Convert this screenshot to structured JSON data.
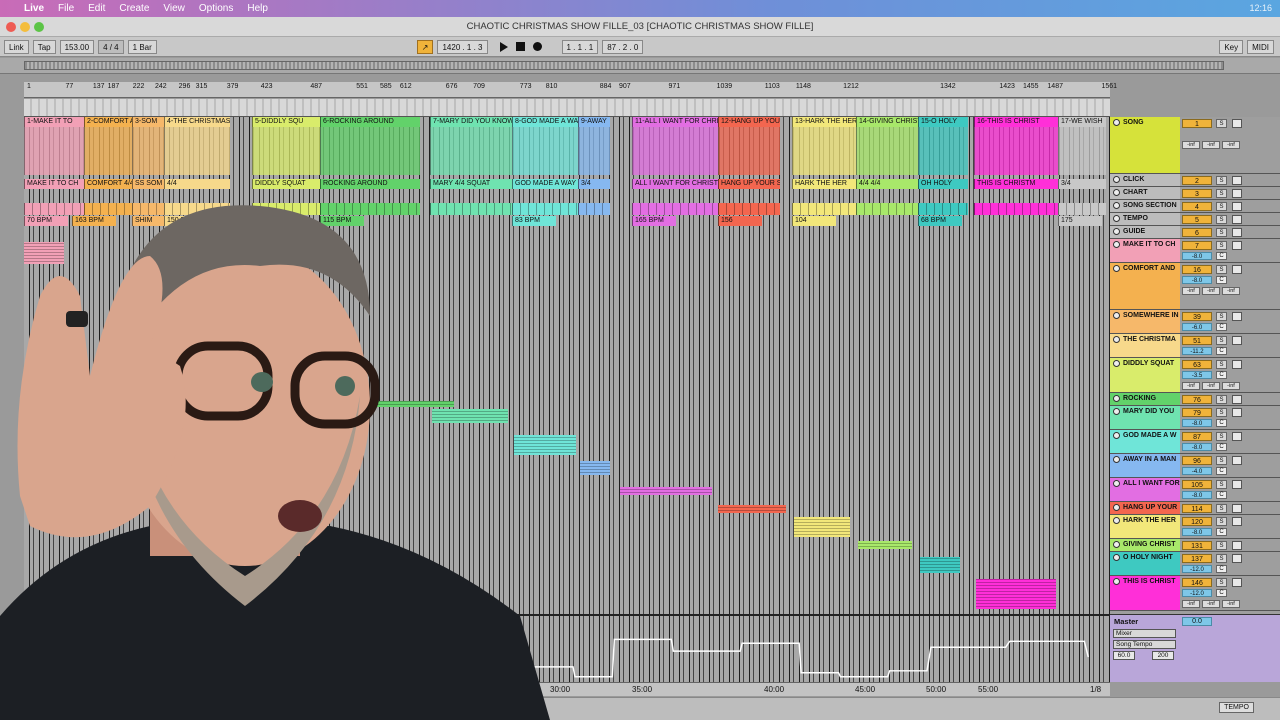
{
  "menubar": {
    "app": "Live",
    "items": [
      "File",
      "Edit",
      "Create",
      "View",
      "Options",
      "Help"
    ],
    "clock": "12:16"
  },
  "window": {
    "title": "CHAOTIC CHRISTMAS SHOW FILLE_03  [CHAOTIC CHRISTMAS SHOW FILLE]"
  },
  "transport": {
    "link": "Link",
    "tap": "Tap",
    "tempo": "153.00",
    "signature": "4 / 4",
    "quantize": "1 Bar",
    "position": "1420 .  1 .  3",
    "loop_start": "1 .  1 .  1",
    "loop_length": "87 .  2 .  0",
    "key": "Key",
    "midi": "MIDI"
  },
  "ruler": {
    "bars": [
      "1",
      "77",
      "137",
      "187",
      "222",
      "242",
      "296",
      "315",
      "379",
      "423",
      "487",
      "551",
      "585",
      "612",
      "676",
      "709",
      "773",
      "810",
      "884",
      "907",
      "971",
      "1039",
      "1103",
      "1148",
      "1212",
      "1342",
      "1423",
      "1455",
      "1487",
      "1561"
    ]
  },
  "timeline": {
    "marks": [
      "30:00",
      "35:00",
      "40:00",
      "45:00",
      "50:00",
      "55:00"
    ],
    "scale_label": "1/8"
  },
  "clips": {
    "song": [
      "1-MAKE IT TO",
      "2-COMFORT AND",
      "3-SOM",
      "4-THE CHRISTMAS",
      "5-DIDDLY SQU",
      "6-ROCKING AROUND",
      "7-MARY DID YOU KNOW",
      "8-GOD MADE A WAY",
      "9-AWAY",
      "11-ALL I WANT FOR CHRISTM",
      "12-HANG UP YOUR",
      "13-HARK THE HERA",
      "14-GIVING CHRIST",
      "15-O HOLY",
      "16-THIS IS CHRIST",
      "17-WE WISH"
    ],
    "chart": [
      "MAKE IT TO CH",
      "COMFORT 4/4",
      "SS SOM",
      "4/4",
      "DIDDLY SQUAT",
      "ROCKING AROUND",
      "MARY 4/4 SQUAT",
      "GOD MADE A WAY",
      "3/4",
      "ALL I WANT FOR CHRISTM",
      "HANG UP YOUR STO",
      "HARK THE HER",
      "4/4 4/4",
      "OH HOLY",
      "THIS IS CHRISTM",
      "3/4"
    ],
    "tempo": [
      "70 BPM",
      "163 BPM",
      "SHIM",
      "150 BPM",
      "115 BPM",
      "83 BPM",
      "165 BPM",
      "156",
      "104",
      "68 BPM",
      "175"
    ]
  },
  "mixer": {
    "tracks": [
      {
        "name": "SONG",
        "num": "1",
        "color": "#d6e23a",
        "vol": ""
      },
      {
        "name": "CLICK",
        "num": "2",
        "color": "#bcbcbc",
        "vol": ""
      },
      {
        "name": "CHART",
        "num": "3",
        "color": "#bcbcbc",
        "vol": ""
      },
      {
        "name": "SONG SECTION",
        "num": "4",
        "color": "#bcbcbc",
        "vol": ""
      },
      {
        "name": "TEMPO",
        "num": "5",
        "color": "#bcbcbc",
        "vol": ""
      },
      {
        "name": "GUIDE",
        "num": "6",
        "color": "#bcbcbc",
        "vol": ""
      },
      {
        "name": "MAKE IT TO CH",
        "num": "7",
        "color": "#f2a0b6",
        "vol": "-8.0"
      },
      {
        "name": "COMFORT AND",
        "num": "16",
        "color": "#f4b14f",
        "vol": "-8.0"
      },
      {
        "name": "SOMEWHERE IN",
        "num": "39",
        "color": "#f6b86a",
        "vol": "-6.0"
      },
      {
        "name": "THE CHRISTMA",
        "num": "51",
        "color": "#f7d98b",
        "vol": "-11.2"
      },
      {
        "name": "DIDDLY SQUAT",
        "num": "63",
        "color": "#d9ec6b",
        "vol": "-3.5"
      },
      {
        "name": "ROCKING",
        "num": "76",
        "color": "#62d26a",
        "vol": ""
      },
      {
        "name": "MARY DID YOU",
        "num": "79",
        "color": "#6fe3b0",
        "vol": "-8.0"
      },
      {
        "name": "GOD MADE A W",
        "num": "87",
        "color": "#6fe5d8",
        "vol": "-8.0"
      },
      {
        "name": "AWAY IN A MAN",
        "num": "96",
        "color": "#86b8f0",
        "vol": "-4.0"
      },
      {
        "name": "ALL I WANT FOR",
        "num": "105",
        "color": "#e26ee2",
        "vol": "-8.0"
      },
      {
        "name": "HANG UP YOUR",
        "num": "114",
        "color": "#f3664f",
        "vol": ""
      },
      {
        "name": "HARK THE HER",
        "num": "120",
        "color": "#f2e77a",
        "vol": "-8.0"
      },
      {
        "name": "GIVING CHRIST",
        "num": "131",
        "color": "#a8e86a",
        "vol": ""
      },
      {
        "name": "O HOLY NIGHT",
        "num": "137",
        "color": "#3ec9c1",
        "vol": "-12.0"
      },
      {
        "name": "THIS IS CHRIST",
        "num": "146",
        "color": "#ff2fd8",
        "vol": "-12.0"
      }
    ],
    "solo": "S",
    "center": "C",
    "inf": "-inf"
  },
  "master": {
    "name": "Master",
    "vol": "0.0",
    "device": "Mixer",
    "param": "Song Tempo",
    "min": "60.0",
    "max": "200",
    "set": "Set"
  },
  "status": {
    "tempo_button": "TEMPO"
  }
}
